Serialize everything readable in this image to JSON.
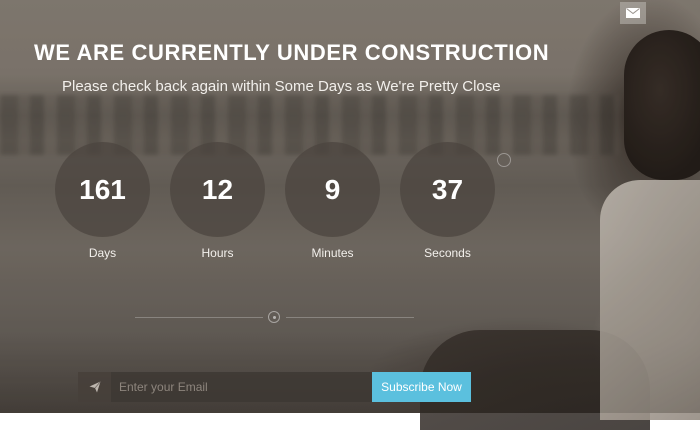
{
  "header": {
    "title": "WE ARE CURRENTLY UNDER CONSTRUCTION",
    "subtitle": "Please check back again within Some Days as We're Pretty Close"
  },
  "contact": {
    "icon": "envelope-icon"
  },
  "countdown": [
    {
      "value": "161",
      "label": "Days"
    },
    {
      "value": "12",
      "label": "Hours"
    },
    {
      "value": "9",
      "label": "Minutes"
    },
    {
      "value": "37",
      "label": "Seconds"
    }
  ],
  "subscribe": {
    "icon": "paper-plane-icon",
    "placeholder": "Enter your Email",
    "value": "",
    "button_label": "Subscribe Now"
  },
  "colors": {
    "accent": "#5bc0de",
    "circle": "#4b443e"
  }
}
